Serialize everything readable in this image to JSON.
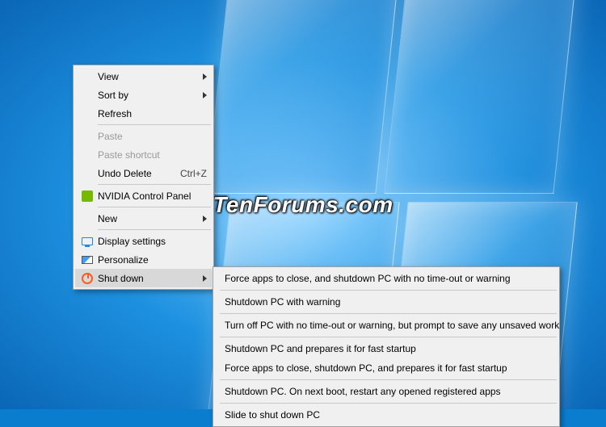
{
  "watermark": "TenForums.com",
  "main_menu": {
    "view": {
      "label": "View",
      "has_submenu": true
    },
    "sort_by": {
      "label": "Sort by",
      "has_submenu": true
    },
    "refresh": {
      "label": "Refresh"
    },
    "paste": {
      "label": "Paste",
      "disabled": true
    },
    "paste_shortcut": {
      "label": "Paste shortcut",
      "disabled": true
    },
    "undo_delete": {
      "label": "Undo Delete",
      "shortcut": "Ctrl+Z"
    },
    "nvidia": {
      "label": "NVIDIA Control Panel",
      "icon": "nvidia-icon"
    },
    "new": {
      "label": "New",
      "has_submenu": true
    },
    "display": {
      "label": "Display settings",
      "icon": "display-icon"
    },
    "personalize": {
      "label": "Personalize",
      "icon": "personalize-icon"
    },
    "shutdown": {
      "label": "Shut down",
      "icon": "shutdown-icon",
      "has_submenu": true,
      "highlighted": true
    }
  },
  "shutdown_submenu": {
    "force_no_timeout": "Force apps to close, and shutdown PC with no time-out or warning",
    "with_warning": "Shutdown PC with warning",
    "prompt_save": "Turn off PC with no time-out or warning, but prompt to save any unsaved work",
    "fast_startup": "Shutdown PC and prepares it for fast startup",
    "force_fast_startup": "Force apps to close, shutdown PC, and prepares it for fast startup",
    "restart_apps": "Shutdown PC. On next boot, restart any opened registered apps",
    "slide": "Slide to shut down PC"
  }
}
